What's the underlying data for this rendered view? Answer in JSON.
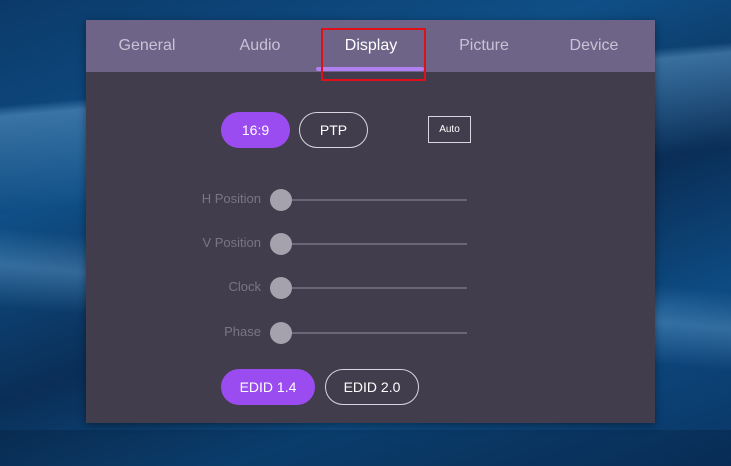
{
  "tabs": [
    {
      "label": "General"
    },
    {
      "label": "Audio"
    },
    {
      "label": "Display"
    },
    {
      "label": "Picture"
    },
    {
      "label": "Device"
    }
  ],
  "active_tab": "Display",
  "aspect": {
    "ratio_16_9": "16:9",
    "ptp": "PTP",
    "auto": "Auto",
    "selected": "16:9"
  },
  "sliders": [
    {
      "label": "H Position",
      "value_fraction": 0
    },
    {
      "label": "V Position",
      "value_fraction": 0
    },
    {
      "label": "Clock",
      "value_fraction": 0
    },
    {
      "label": "Phase",
      "value_fraction": 0
    }
  ],
  "edid": {
    "v14": "EDID 1.4",
    "v20": "EDID 2.0",
    "selected": "EDID 1.4"
  },
  "colors": {
    "accent": "#9b4cf0",
    "tab_bar": "#6d6487",
    "panel": "#423d4c",
    "highlight": "#e0101a"
  }
}
